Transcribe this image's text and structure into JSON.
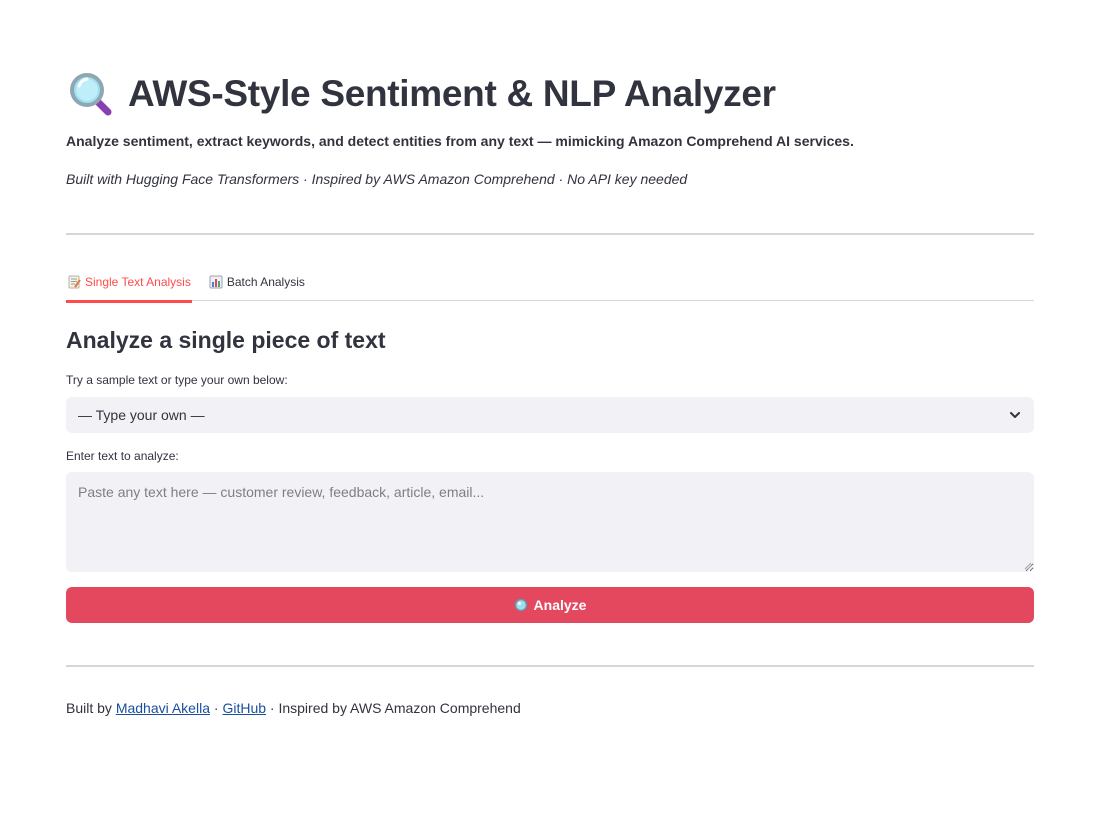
{
  "header": {
    "title_icon": "magnifying-glass-icon",
    "title": "AWS-Style Sentiment & NLP Analyzer",
    "subtitle": "Analyze sentiment, extract keywords, and detect entities from any text — mimicking Amazon Comprehend AI services.",
    "caption": "Built with Hugging Face Transformers · Inspired by AWS Amazon Comprehend · No API key needed"
  },
  "tabs": [
    {
      "label": "Single Text Analysis",
      "icon": "memo-icon",
      "active": true
    },
    {
      "label": "Batch Analysis",
      "icon": "bar-chart-icon",
      "active": false
    }
  ],
  "main": {
    "section_title": "Analyze a single piece of text",
    "sample_label": "Try a sample text or type your own below:",
    "sample_selected": "— Type your own —",
    "text_label": "Enter text to analyze:",
    "text_value": "",
    "text_placeholder": "Paste any text here — customer review, feedback, article, email...",
    "analyze_label": "Analyze"
  },
  "footer": {
    "prefix": "Built by ",
    "author_link": "Madhavi Akella",
    "sep1": " · ",
    "github_link": "GitHub",
    "suffix": " · Inspired by AWS Amazon Comprehend"
  },
  "colors": {
    "accent": "#ff4b4b",
    "button": "#e4485f",
    "input_bg": "#f2f2f6",
    "link": "#1a4fa0"
  }
}
